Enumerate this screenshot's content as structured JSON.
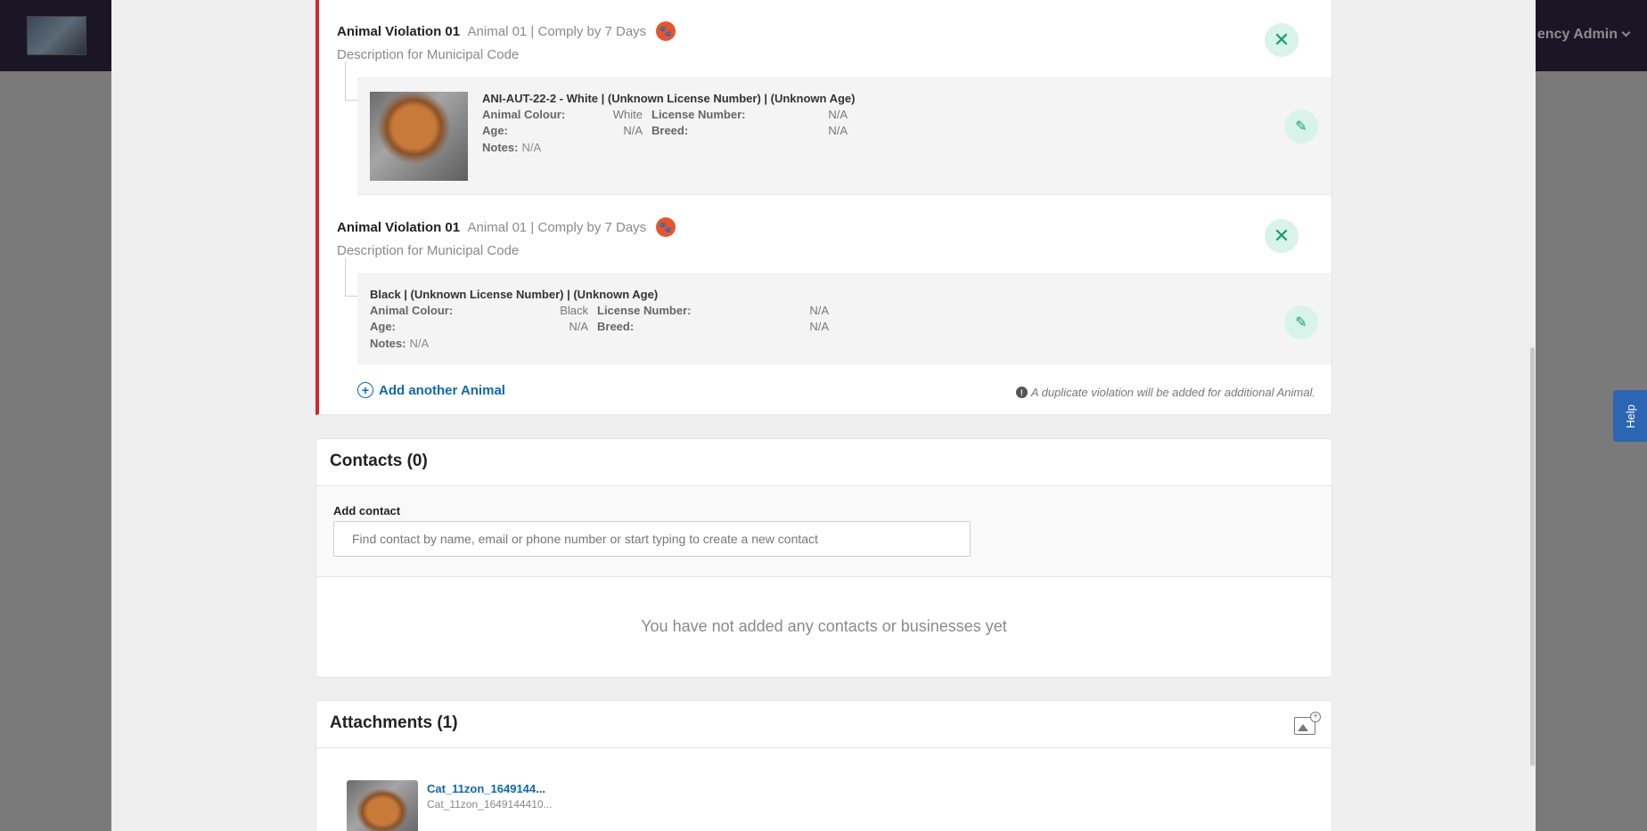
{
  "backdrop": {
    "user_menu_label": "ency Admin",
    "help_label": "Help"
  },
  "violations": [
    {
      "title": "Animal Violation 01",
      "meta": "Animal 01 | Comply by 7 Days",
      "description": "Description for Municipal Code",
      "animal": {
        "name": "ANI-AUT-22-2 - White | (Unknown License Number) | (Unknown Age)",
        "colour_label": "Animal Colour:",
        "colour_value": "White",
        "license_label": "License Number:",
        "license_value": "N/A",
        "age_label": "Age:",
        "age_value": "N/A",
        "breed_label": "Breed:",
        "breed_value": "N/A",
        "notes_label": "Notes:",
        "notes_value": "N/A"
      }
    },
    {
      "title": "Animal Violation 01",
      "meta": "Animal 01 | Comply by 7 Days",
      "description": "Description for Municipal Code",
      "animal": {
        "name": "Black | (Unknown License Number) | (Unknown Age)",
        "colour_label": "Animal Colour:",
        "colour_value": "Black",
        "license_label": "License Number:",
        "license_value": "N/A",
        "age_label": "Age:",
        "age_value": "N/A",
        "breed_label": "Breed:",
        "breed_value": "N/A",
        "notes_label": "Notes:",
        "notes_value": "N/A"
      }
    }
  ],
  "add_animal_label": "Add another Animal",
  "duplicate_note": "A duplicate violation will be added for additional Animal.",
  "contacts": {
    "title": "Contacts (0)",
    "add_label": "Add contact",
    "placeholder": "Find contact by name, email or phone number or start typing to create a new contact",
    "empty_text": "You have not added any contacts or businesses yet"
  },
  "attachments": {
    "title": "Attachments (1)",
    "items": [
      {
        "name": "Cat_11zon_1649144...",
        "subtitle": "Cat_11zon_1649144410..."
      }
    ]
  },
  "colors": {
    "violation_accent": "#d9232a",
    "action_green": "#1a9d6e",
    "action_green_bg": "#d8f3ea",
    "link_blue": "#1167b1",
    "paw_orange": "#e4572e"
  }
}
